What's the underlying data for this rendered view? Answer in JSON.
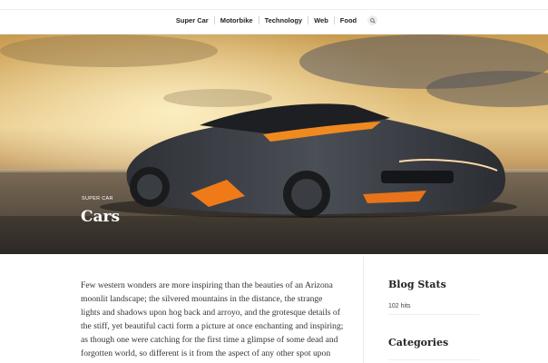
{
  "nav": {
    "items": [
      "Super Car",
      "Motorbike",
      "Technology",
      "Web",
      "Food"
    ],
    "search_icon": "search-icon"
  },
  "hero": {
    "category": "SUPER CAR",
    "title": "Cars",
    "image": "sports-car-photo"
  },
  "article": {
    "text": "Few western wonders are more inspiring than the beauties of an Arizona moonlit landscape; the silvered mountains in the distance, the strange lights and shadows upon hog back and arroyo, and the grotesque details of the stiff, yet beautiful cacti form a picture at once enchanting and inspiring; as though one were catching for the first time a glimpse of some dead and forgotten world, so different is it from the aspect of any other spot upon our earth."
  },
  "sidebar": {
    "blog_stats": {
      "title": "Blog Stats",
      "value": "102 hits"
    },
    "categories": {
      "title": "Categories"
    }
  }
}
